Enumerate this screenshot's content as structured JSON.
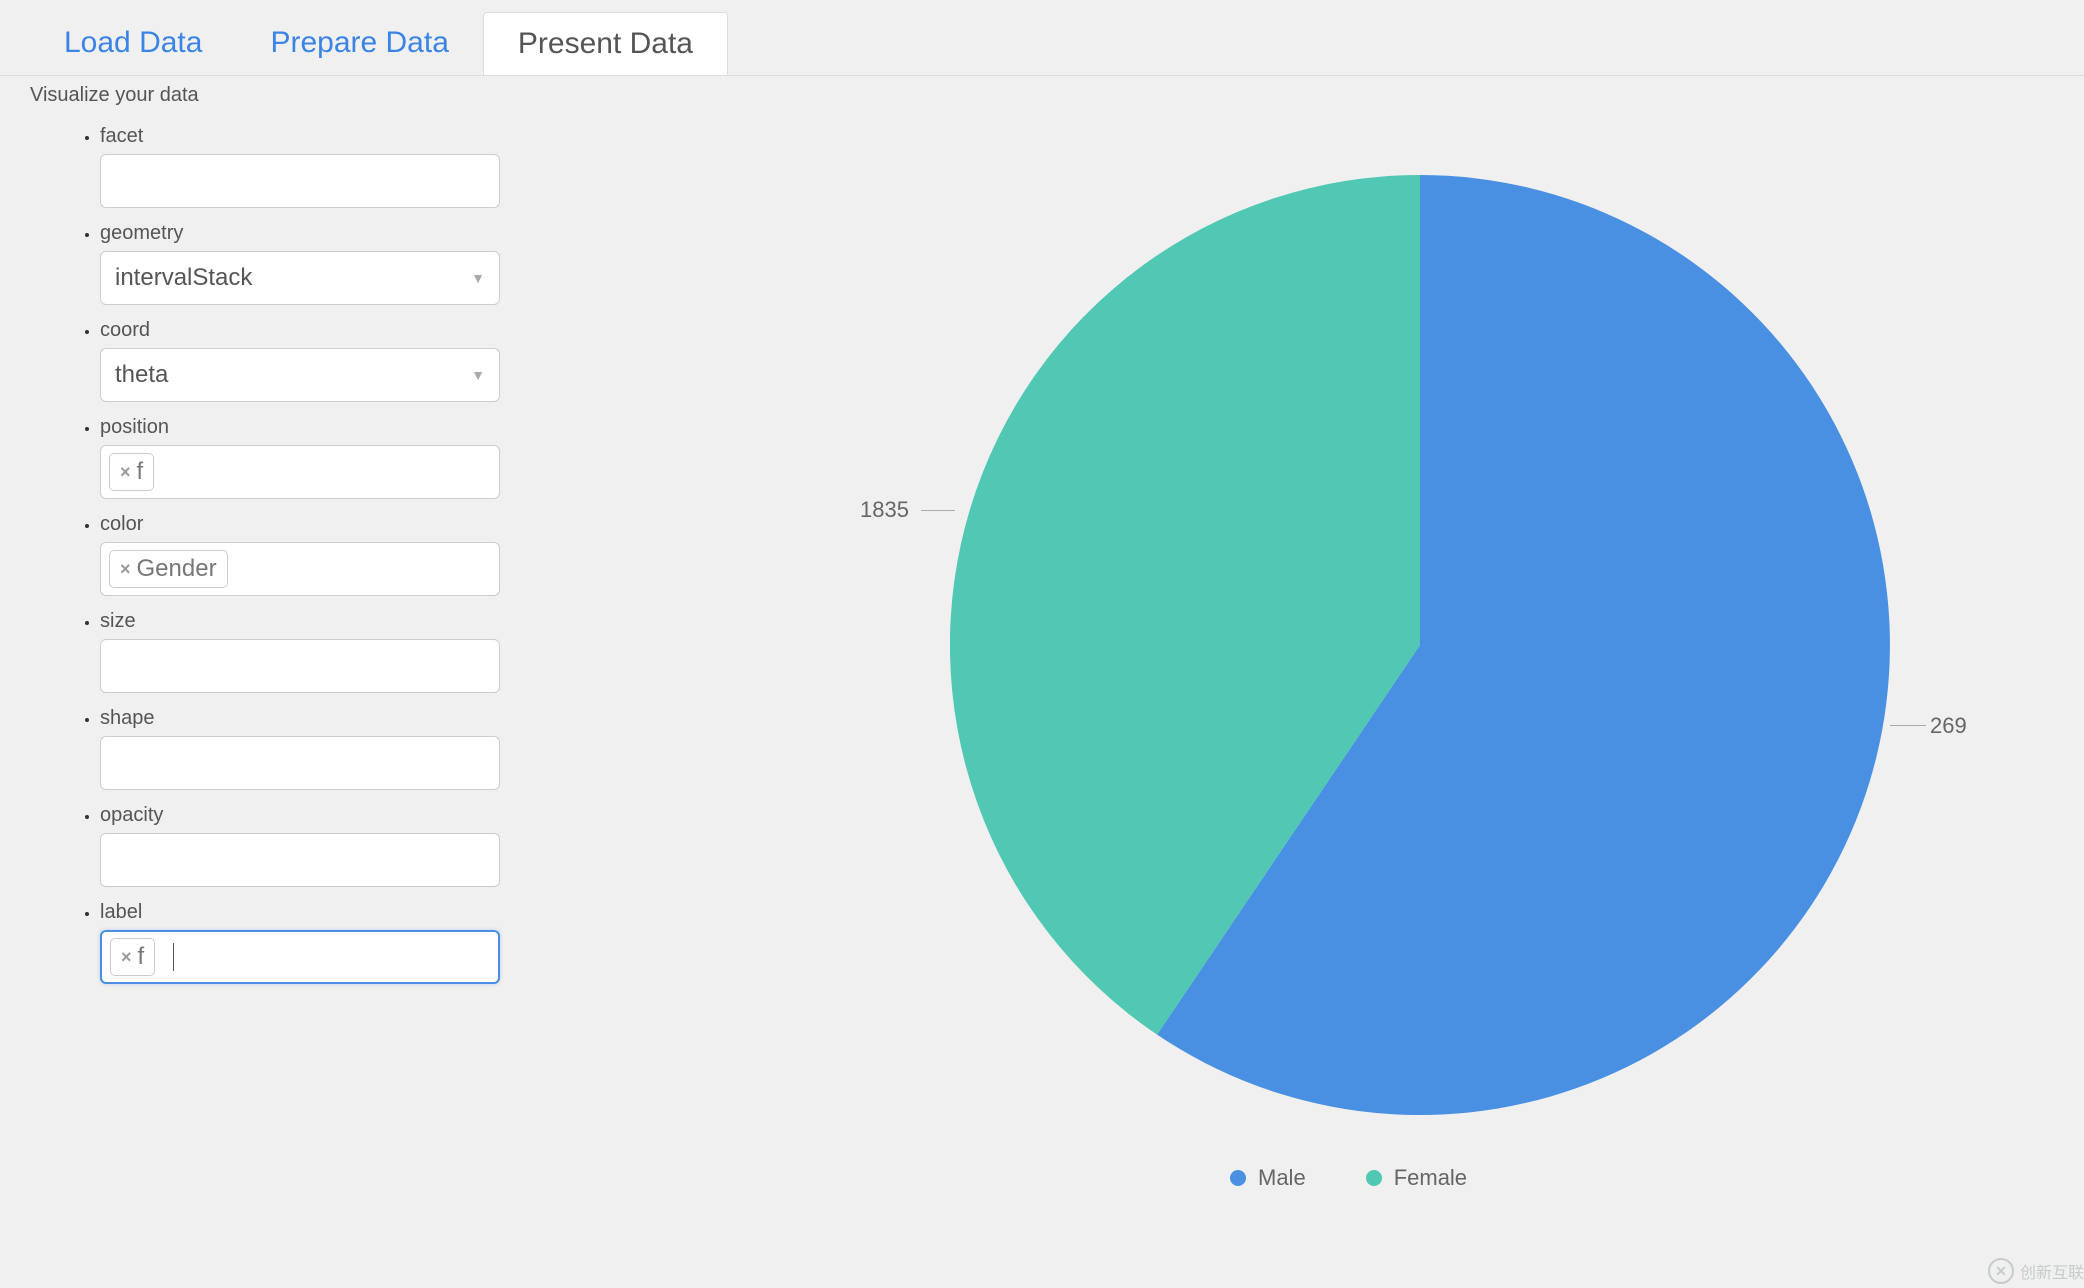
{
  "tabs": {
    "load": "Load Data",
    "prepare": "Prepare Data",
    "present": "Present Data"
  },
  "subheading": "Visualize your data",
  "form": {
    "facet": {
      "label": "facet",
      "value": ""
    },
    "geometry": {
      "label": "geometry",
      "value": "intervalStack"
    },
    "coord": {
      "label": "coord",
      "value": "theta"
    },
    "position": {
      "label": "position",
      "tag": "f"
    },
    "color": {
      "label": "color",
      "tag": "Gender"
    },
    "size": {
      "label": "size",
      "value": ""
    },
    "shape": {
      "label": "shape",
      "value": ""
    },
    "opacity": {
      "label": "opacity",
      "value": ""
    },
    "label": {
      "label": "label",
      "tag": "f"
    }
  },
  "chart_data": {
    "type": "pie",
    "series": [
      {
        "name": "Male",
        "value": 2691,
        "color": "#4a90e2"
      },
      {
        "name": "Female",
        "value": 1835,
        "color": "#50c8b4"
      }
    ],
    "labels": {
      "male": "269",
      "female": "1835"
    }
  },
  "legend": {
    "male": "Male",
    "female": "Female"
  },
  "watermark": "创新互联"
}
